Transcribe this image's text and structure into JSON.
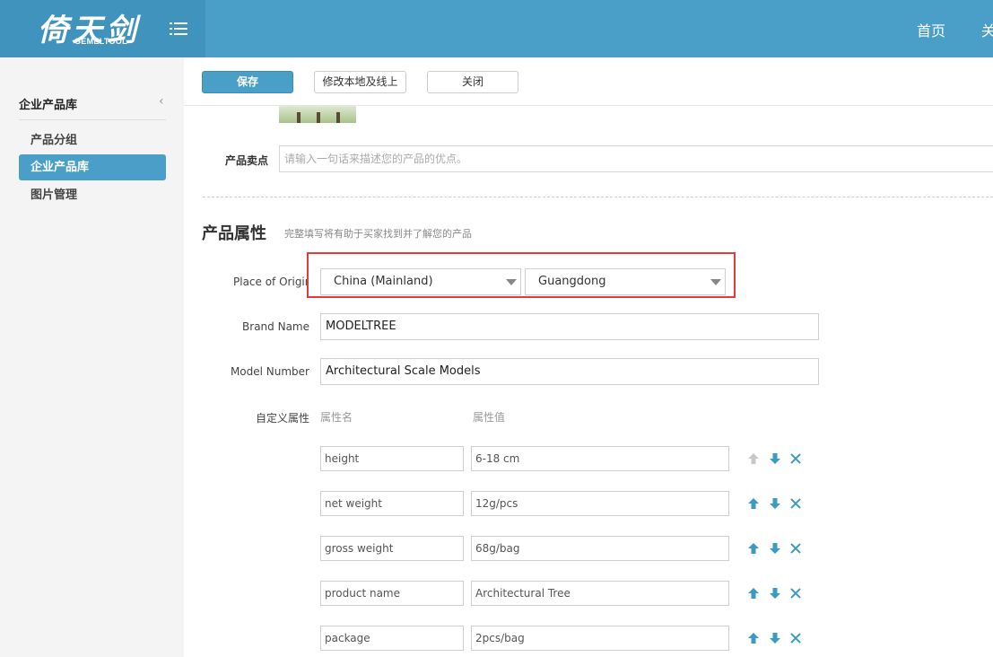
{
  "header": {
    "logo_text": "倚天剑",
    "logo_sub": "GEMELTOOL",
    "nav": [
      "首页",
      "关"
    ],
    "colors": {
      "bar": "#4a9fc8",
      "logo_bg": "#3f93bc"
    }
  },
  "sidebar": {
    "title": "企业产品库",
    "items": [
      {
        "label": "产品分组",
        "active": false
      },
      {
        "label": "企业产品库",
        "active": true
      },
      {
        "label": "图片管理",
        "active": false
      }
    ]
  },
  "toolbar": {
    "save_label": "保存",
    "modify_label": "修改本地及线上",
    "close_label": "关闭"
  },
  "form": {
    "selling_point": {
      "label": "产品卖点",
      "placeholder": "请输入一句话来描述您的产品的优点。"
    },
    "section_title": "产品属性",
    "section_hint": "完整填写将有助于买家找到并了解您的产品",
    "place_of_origin": {
      "label": "Place of Origin",
      "country": "China (Mainland)",
      "province": "Guangdong"
    },
    "brand_name": {
      "label": "Brand Name",
      "value": "MODELTREE"
    },
    "model_number": {
      "label": "Model Number",
      "value": "Architectural Scale Models"
    },
    "custom": {
      "label": "自定义属性",
      "col_name": "属性名",
      "col_value": "属性值",
      "rows": [
        {
          "name": "height",
          "value": "6-18 cm"
        },
        {
          "name": "net weight",
          "value": "12g/pcs"
        },
        {
          "name": "gross weight",
          "value": "68g/bag"
        },
        {
          "name": "product name",
          "value": "Architectural Tree"
        },
        {
          "name": "package",
          "value": "2pcs/bag"
        }
      ]
    }
  },
  "icons": {
    "up": "arrow-up-icon",
    "down": "arrow-down-icon",
    "remove": "close-icon",
    "accent": "#3b9bc4",
    "disabled": "#c8c8c8"
  }
}
